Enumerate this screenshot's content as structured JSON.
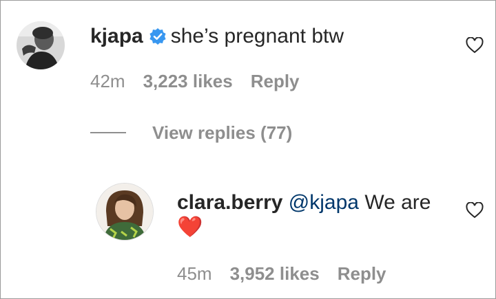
{
  "comments": [
    {
      "username": "kjapa",
      "verified": true,
      "text": "she’s pregnant btw",
      "time": "42m",
      "likes": "3,223 likes",
      "reply": "Reply"
    },
    {
      "username": "clara.berry",
      "mention": "@kjapa",
      "text": "We are",
      "emoji": "❤️",
      "time": "45m",
      "likes": "3,952 likes",
      "reply": "Reply"
    }
  ],
  "replies": {
    "label": "View replies (77)"
  },
  "colors": {
    "text": "#262626",
    "meta": "#8e8e8e",
    "mention": "#00376b",
    "verified": "#3897f0",
    "heart": "#e0245e"
  },
  "icons": [
    "verified-badge-icon",
    "heart-outline-icon",
    "red-heart-emoji"
  ]
}
